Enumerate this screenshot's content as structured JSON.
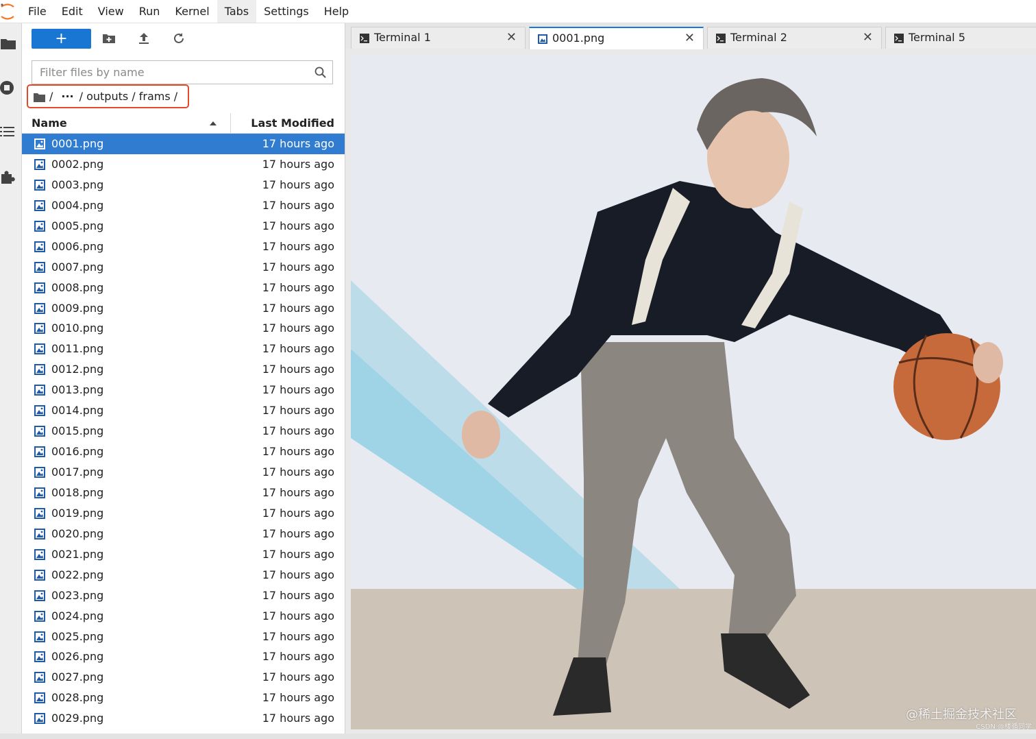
{
  "menubar": {
    "items": [
      "File",
      "Edit",
      "View",
      "Run",
      "Kernel",
      "Tabs",
      "Settings",
      "Help"
    ],
    "active": "Tabs"
  },
  "toolbar": {
    "new_label": "+"
  },
  "filter": {
    "placeholder": "Filter files by name"
  },
  "breadcrumb": {
    "root": "/",
    "ellipsis": "···",
    "path": "/ outputs / frams /"
  },
  "list": {
    "name_header": "Name",
    "modified_header": "Last Modified",
    "files": [
      {
        "name": "0001.png",
        "modified": "17 hours ago"
      },
      {
        "name": "0002.png",
        "modified": "17 hours ago"
      },
      {
        "name": "0003.png",
        "modified": "17 hours ago"
      },
      {
        "name": "0004.png",
        "modified": "17 hours ago"
      },
      {
        "name": "0005.png",
        "modified": "17 hours ago"
      },
      {
        "name": "0006.png",
        "modified": "17 hours ago"
      },
      {
        "name": "0007.png",
        "modified": "17 hours ago"
      },
      {
        "name": "0008.png",
        "modified": "17 hours ago"
      },
      {
        "name": "0009.png",
        "modified": "17 hours ago"
      },
      {
        "name": "0010.png",
        "modified": "17 hours ago"
      },
      {
        "name": "0011.png",
        "modified": "17 hours ago"
      },
      {
        "name": "0012.png",
        "modified": "17 hours ago"
      },
      {
        "name": "0013.png",
        "modified": "17 hours ago"
      },
      {
        "name": "0014.png",
        "modified": "17 hours ago"
      },
      {
        "name": "0015.png",
        "modified": "17 hours ago"
      },
      {
        "name": "0016.png",
        "modified": "17 hours ago"
      },
      {
        "name": "0017.png",
        "modified": "17 hours ago"
      },
      {
        "name": "0018.png",
        "modified": "17 hours ago"
      },
      {
        "name": "0019.png",
        "modified": "17 hours ago"
      },
      {
        "name": "0020.png",
        "modified": "17 hours ago"
      },
      {
        "name": "0021.png",
        "modified": "17 hours ago"
      },
      {
        "name": "0022.png",
        "modified": "17 hours ago"
      },
      {
        "name": "0023.png",
        "modified": "17 hours ago"
      },
      {
        "name": "0024.png",
        "modified": "17 hours ago"
      },
      {
        "name": "0025.png",
        "modified": "17 hours ago"
      },
      {
        "name": "0026.png",
        "modified": "17 hours ago"
      },
      {
        "name": "0027.png",
        "modified": "17 hours ago"
      },
      {
        "name": "0028.png",
        "modified": "17 hours ago"
      },
      {
        "name": "0029.png",
        "modified": "17 hours ago"
      }
    ],
    "selected_index": 0
  },
  "tabs": [
    {
      "label": "Terminal 1",
      "icon": "terminal-icon",
      "active": false,
      "closable": true
    },
    {
      "label": "0001.png",
      "icon": "image-icon",
      "active": true,
      "closable": true
    },
    {
      "label": "Terminal 2",
      "icon": "terminal-icon",
      "active": false,
      "closable": true
    },
    {
      "label": "Terminal 5",
      "icon": "terminal-icon",
      "active": false,
      "closable": false
    }
  ],
  "viewer": {
    "watermark": "@稀土掘金技术社区",
    "watermark_small": "CSDN @楼循同学"
  },
  "colors": {
    "accent": "#1976d2",
    "selection": "#2f7cd0",
    "breadcrumb_highlight": "#e24a2a"
  }
}
